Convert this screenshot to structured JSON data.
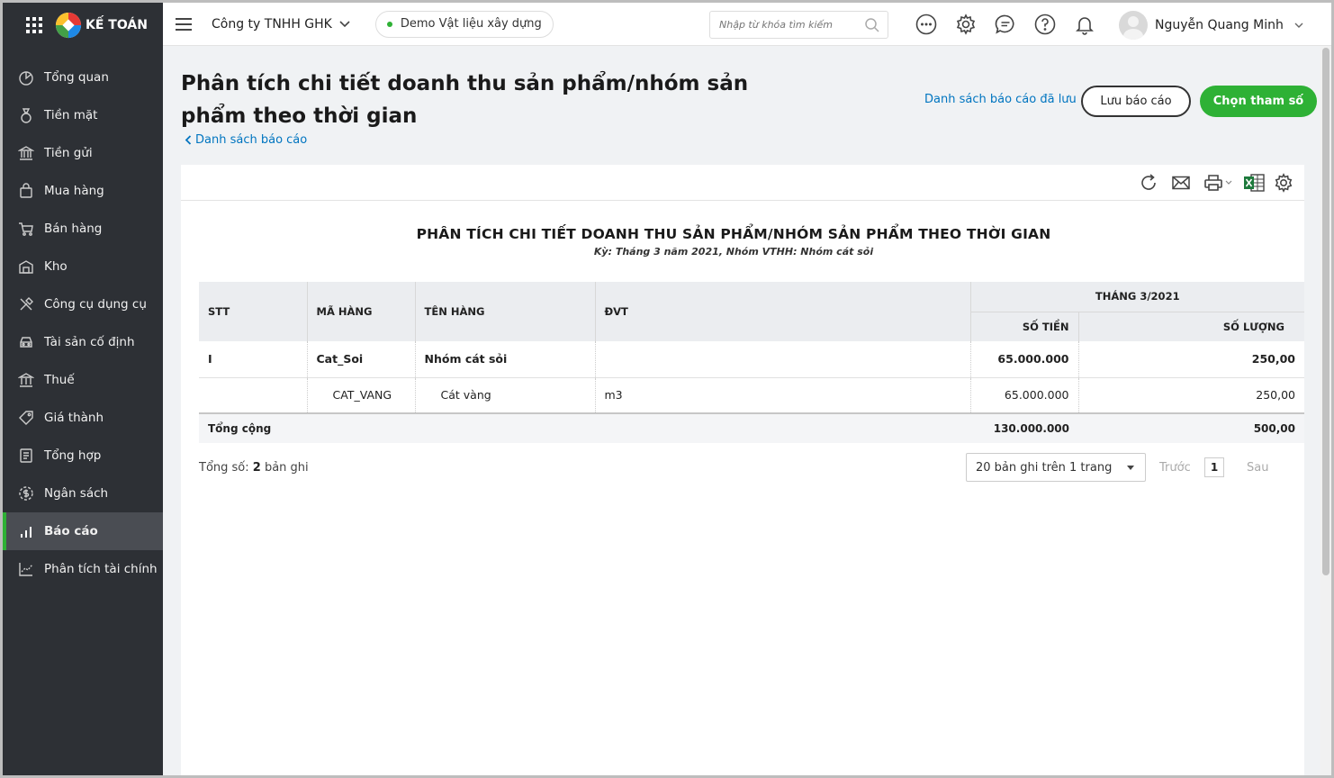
{
  "brand": {
    "name": "KẾ TOÁN"
  },
  "sidebar": {
    "items": [
      {
        "label": "Tổng quan",
        "icon": "dashboard-icon"
      },
      {
        "label": "Tiền mặt",
        "icon": "cash-icon"
      },
      {
        "label": "Tiền gửi",
        "icon": "bank-icon"
      },
      {
        "label": "Mua hàng",
        "icon": "shopping-bag-icon"
      },
      {
        "label": "Bán hàng",
        "icon": "cart-icon"
      },
      {
        "label": "Kho",
        "icon": "warehouse-icon"
      },
      {
        "label": "Công cụ dụng cụ",
        "icon": "tools-icon"
      },
      {
        "label": "Tài sản cố định",
        "icon": "car-icon"
      },
      {
        "label": "Thuế",
        "icon": "tax-icon"
      },
      {
        "label": "Giá thành",
        "icon": "price-tag-icon"
      },
      {
        "label": "Tổng hợp",
        "icon": "ledger-icon"
      },
      {
        "label": "Ngân sách",
        "icon": "budget-icon"
      },
      {
        "label": "Báo cáo",
        "icon": "report-chart-icon",
        "active": true
      },
      {
        "label": "Phân tích tài chính",
        "icon": "analytics-icon"
      }
    ]
  },
  "topbar": {
    "company": "Công ty TNHH GHK",
    "database": "Demo Vật liệu xây dựng",
    "search_placeholder": "Nhập từ khóa tìm kiếm",
    "user_name": "Nguyễn Quang Minh"
  },
  "page": {
    "title": "Phân tích chi tiết doanh thu sản phẩm/nhóm sản phẩm theo thời gian",
    "back_link": "Danh sách báo cáo",
    "saved_reports_link": "Danh sách báo cáo đã lưu",
    "save_button": "Lưu báo cáo",
    "params_button": "Chọn tham số"
  },
  "report": {
    "title": "PHÂN TÍCH CHI TIẾT DOANH THU SẢN PHẨM/NHÓM SẢN PHẨM THEO THỜI GIAN",
    "subtitle": "Kỳ: Tháng 3 năm 2021, Nhóm VTHH: Nhóm cát sỏi",
    "columns": {
      "stt": "STT",
      "ma_hang": "MÃ HÀNG",
      "ten_hang": "TÊN HÀNG",
      "dvt": "ĐVT",
      "month": "THÁNG 3/2021",
      "so_tien": "SỐ TIỀN",
      "so_luong": "SỐ LƯỢNG"
    },
    "rows": [
      {
        "stt": "I",
        "ma_hang": "Cat_Soi",
        "ten_hang": "Nhóm cát sỏi",
        "dvt": "",
        "so_tien": "65.000.000",
        "so_luong": "250,00"
      },
      {
        "stt": "",
        "ma_hang": "CAT_VANG",
        "ten_hang": "Cát vàng",
        "dvt": "m3",
        "so_tien": "65.000.000",
        "so_luong": "250,00"
      }
    ],
    "total": {
      "label": "Tổng cộng",
      "so_tien": "130.000.000",
      "so_luong": "500,00"
    }
  },
  "pagination": {
    "total_prefix": "Tổng số:",
    "total_count": "2",
    "total_suffix": "bản ghi",
    "page_size": "20 bản ghi trên 1 trang",
    "prev": "Trước",
    "current_page": "1",
    "next": "Sau"
  },
  "colors": {
    "accent": "#2eb135",
    "link": "#0075c0",
    "sidebar": "#2d3035"
  }
}
